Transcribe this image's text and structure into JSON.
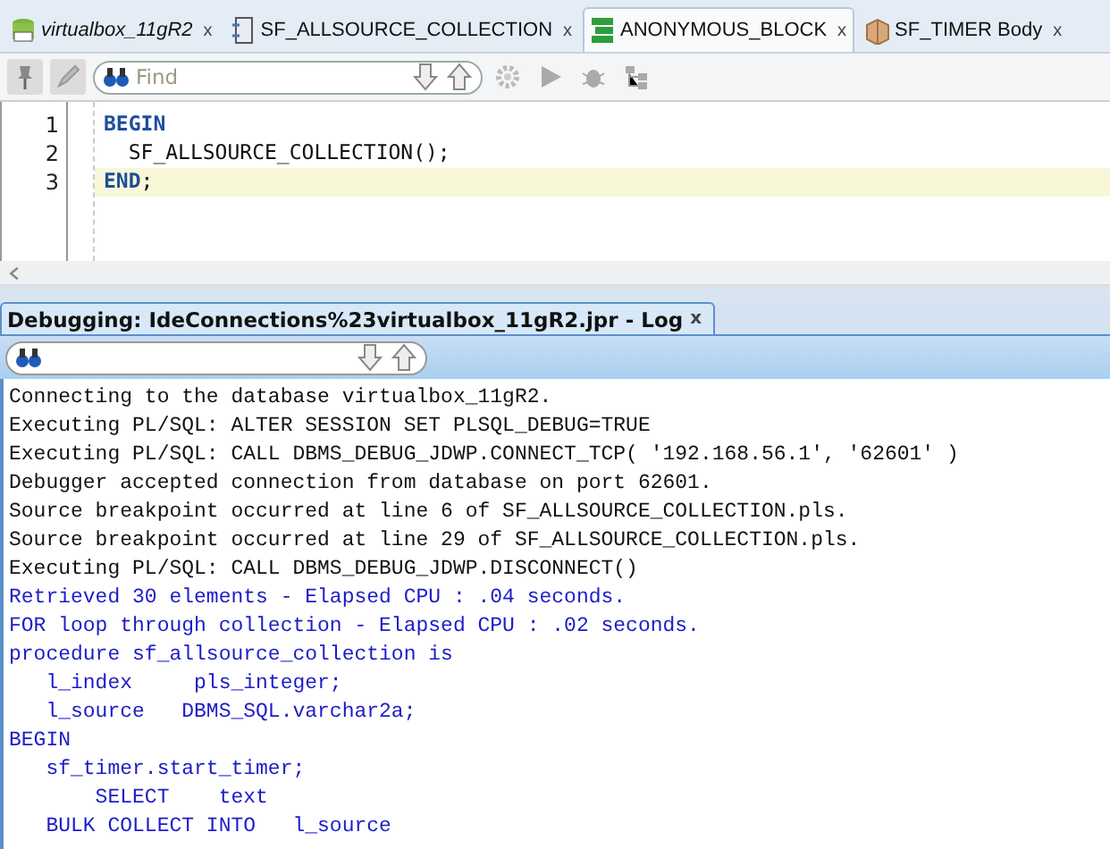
{
  "editor_tabs": [
    {
      "label": "virtualbox_11gR2",
      "kind": "connection",
      "italic": true,
      "selected": false,
      "close": "x"
    },
    {
      "label": "SF_ALLSOURCE_COLLECTION",
      "kind": "procedure",
      "italic": false,
      "selected": false,
      "close": "x"
    },
    {
      "label": "ANONYMOUS_BLOCK",
      "kind": "block",
      "italic": false,
      "selected": true,
      "close": "x"
    },
    {
      "label": "SF_TIMER Body",
      "kind": "package",
      "italic": false,
      "selected": false,
      "close": "x"
    }
  ],
  "toolbar": {
    "find": {
      "placeholder": "Find"
    }
  },
  "editor": {
    "lines": [
      {
        "number": "1",
        "current": false,
        "segments": [
          {
            "text": "BEGIN",
            "keyword": true
          }
        ]
      },
      {
        "number": "2",
        "current": false,
        "segments": [
          {
            "text": "  SF_ALLSOURCE_COLLECTION();",
            "keyword": false
          }
        ]
      },
      {
        "number": "3",
        "current": true,
        "segments": [
          {
            "text": "END",
            "keyword": true
          },
          {
            "text": ";",
            "keyword": false
          }
        ]
      }
    ]
  },
  "log_panel": {
    "tab": {
      "label": "Debugging: IdeConnections%23virtualbox_11gR2.jpr - Log",
      "close": "x",
      "selected": true
    },
    "lines": [
      {
        "kind": "system",
        "text": "Connecting to the database virtualbox_11gR2."
      },
      {
        "kind": "system",
        "text": "Executing PL/SQL: ALTER SESSION SET PLSQL_DEBUG=TRUE"
      },
      {
        "kind": "system",
        "text": "Executing PL/SQL: CALL DBMS_DEBUG_JDWP.CONNECT_TCP( '192.168.56.1', '62601' )"
      },
      {
        "kind": "system",
        "text": "Debugger accepted connection from database on port 62601."
      },
      {
        "kind": "system",
        "text": "Source breakpoint occurred at line 6 of SF_ALLSOURCE_COLLECTION.pls."
      },
      {
        "kind": "system",
        "text": "Source breakpoint occurred at line 29 of SF_ALLSOURCE_COLLECTION.pls."
      },
      {
        "kind": "system",
        "text": "Executing PL/SQL: CALL DBMS_DEBUG_JDWP.DISCONNECT()"
      },
      {
        "kind": "output",
        "text": "Retrieved 30 elements - Elapsed CPU : .04 seconds."
      },
      {
        "kind": "output",
        "text": "FOR loop through collection - Elapsed CPU : .02 seconds."
      },
      {
        "kind": "output",
        "text": "procedure sf_allsource_collection is"
      },
      {
        "kind": "output",
        "text": "   l_index     pls_integer;"
      },
      {
        "kind": "output",
        "text": "   l_source   DBMS_SQL.varchar2a;"
      },
      {
        "kind": "output",
        "text": "BEGIN"
      },
      {
        "kind": "output",
        "text": "   sf_timer.start_timer;"
      },
      {
        "kind": "output",
        "text": "       SELECT    text"
      },
      {
        "kind": "output",
        "text": "   BULK COLLECT INTO   l_source"
      }
    ]
  }
}
